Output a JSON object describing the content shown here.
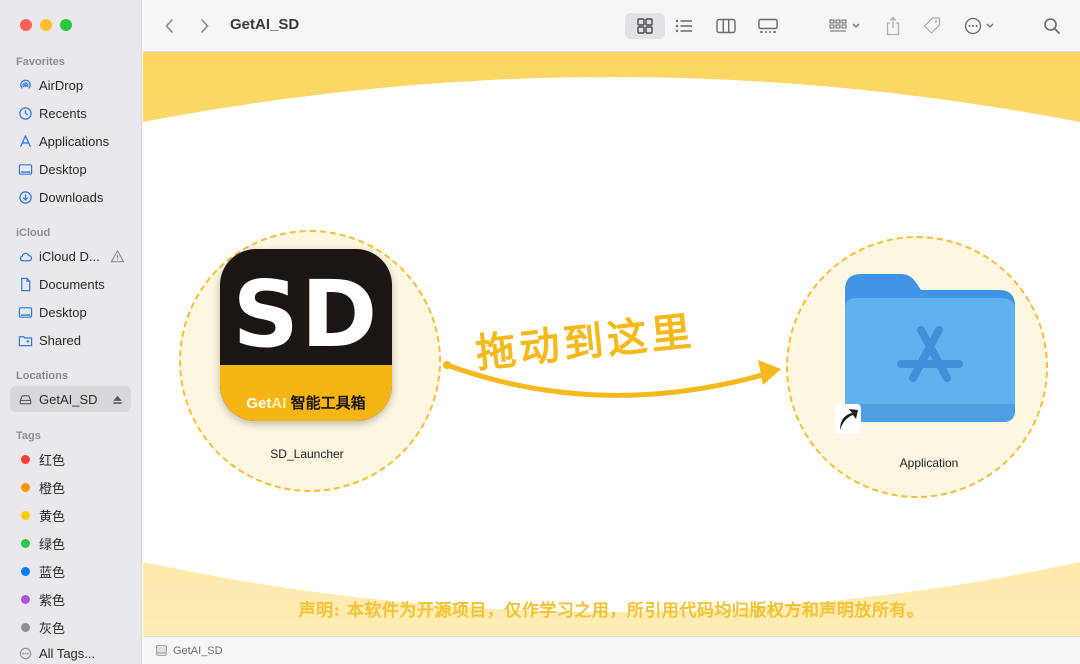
{
  "window": {
    "title": "GetAI_SD",
    "traffic_colors": [
      "#fe5f57",
      "#febc2e",
      "#28c840"
    ]
  },
  "sidebar": {
    "favorites_title": "Favorites",
    "favorites": [
      {
        "label": "AirDrop",
        "icon": "airdrop-icon"
      },
      {
        "label": "Recents",
        "icon": "clock-icon"
      },
      {
        "label": "Applications",
        "icon": "applications-icon"
      },
      {
        "label": "Desktop",
        "icon": "desktop-icon"
      },
      {
        "label": "Downloads",
        "icon": "downloads-icon"
      }
    ],
    "icloud_title": "iCloud",
    "icloud": [
      {
        "label": "iCloud D...",
        "icon": "cloud-icon"
      },
      {
        "label": "Documents",
        "icon": "document-icon"
      },
      {
        "label": "Desktop",
        "icon": "desktop-icon"
      },
      {
        "label": "Shared",
        "icon": "shared-folder-icon"
      }
    ],
    "locations_title": "Locations",
    "locations": [
      {
        "label": "GetAI_SD",
        "icon": "disk-icon",
        "selected": true
      }
    ],
    "tags_title": "Tags",
    "tags": [
      {
        "label": "红色",
        "color": "#fe3b30"
      },
      {
        "label": "橙色",
        "color": "#ff9500"
      },
      {
        "label": "黄色",
        "color": "#ffcc00"
      },
      {
        "label": "绿色",
        "color": "#28cd41"
      },
      {
        "label": "蓝色",
        "color": "#007aff"
      },
      {
        "label": "紫色",
        "color": "#af52de"
      },
      {
        "label": "灰色",
        "color": "#8e8e93"
      },
      {
        "label": "All Tags...",
        "color": ""
      }
    ]
  },
  "content": {
    "app_icon": {
      "top_text": "SD",
      "brand_get": "Get",
      "brand_ai": "AI",
      "brand_cn": "智能工具箱",
      "label": "SD_Launcher"
    },
    "drag_hint": "拖动到这里",
    "target": {
      "label": "Application"
    },
    "disclaimer": "声明: 本软件为开源项目，仅作学习之用，所引用代码均归版权方和声明放所有。",
    "colors": {
      "accent_yellow": "#fbd55e",
      "folder_blue": "#5aa9ea",
      "arrow": "#f5b91c"
    }
  },
  "statusbar": {
    "path": "GetAI_SD"
  }
}
